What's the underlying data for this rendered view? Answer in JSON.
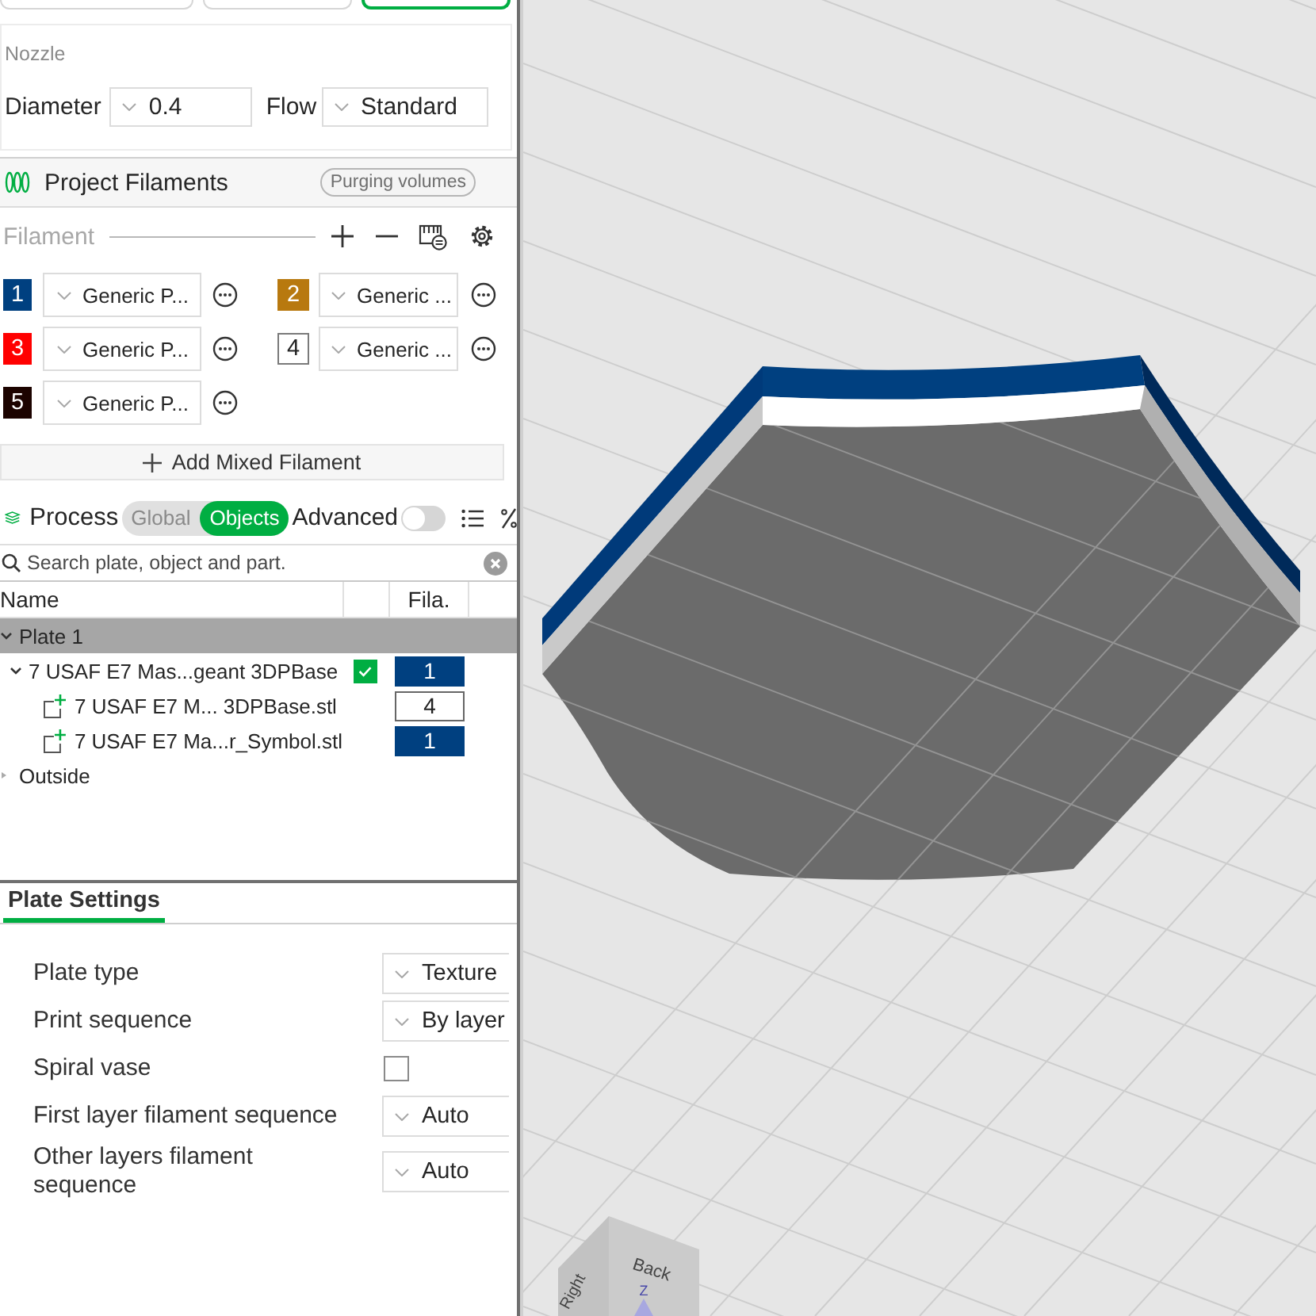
{
  "top_tabs": [
    {
      "selected": false
    },
    {
      "selected": false
    },
    {
      "selected": true
    }
  ],
  "nozzle": {
    "title": "Nozzle",
    "diameter_label": "Diameter",
    "diameter": "0.4",
    "flow_label": "Flow",
    "flow": "Standard"
  },
  "project_filaments": {
    "title": "Project Filaments",
    "purging_button": "Purging volumes",
    "filament_label": "Filament",
    "filaments": [
      {
        "number": "1",
        "color": "#004080",
        "name": "Generic P..."
      },
      {
        "number": "2",
        "color": "#b8790f",
        "name": "Generic ..."
      },
      {
        "number": "3",
        "color": "#ff0000",
        "name": "Generic P..."
      },
      {
        "number": "4",
        "color": "#ffffff",
        "name": "Generic ..."
      },
      {
        "number": "5",
        "color": "#1c0300",
        "name": "Generic P..."
      }
    ],
    "add_mixed_button": "Add Mixed Filament"
  },
  "process": {
    "title": "Process",
    "modes": [
      {
        "label": "Global",
        "selected": false
      },
      {
        "label": "Objects",
        "selected": true
      }
    ],
    "advanced_label": "Advanced",
    "advanced_on": false
  },
  "search": {
    "placeholder": "Search plate, object and part."
  },
  "object_table": {
    "columns": [
      "Name",
      "Fila."
    ],
    "rows": [
      {
        "kind": "plate",
        "name": "Plate 1",
        "selected": true,
        "expanded": true,
        "children": [
          {
            "kind": "object",
            "name": "7 USAF E7 Mas...geant 3DPBase",
            "selected": false,
            "expanded": true,
            "checked": true,
            "filament": {
              "label": "1",
              "color": "#004080"
            },
            "children": [
              {
                "kind": "part",
                "name": "7 USAF E7 M... 3DPBase.stl",
                "selected": false,
                "filament": {
                  "label": "4",
                  "color": "#ffffff"
                }
              },
              {
                "kind": "part",
                "name": "7 USAF E7 Ma...r_Symbol.stl",
                "selected": false,
                "filament": {
                  "label": "1",
                  "color": "#004080"
                }
              }
            ]
          }
        ]
      },
      {
        "kind": "plate",
        "name": "Outside",
        "selected": false,
        "expanded": false
      }
    ]
  },
  "plate_settings": {
    "tabs": [
      {
        "label": "Plate Settings",
        "selected": true
      }
    ],
    "settings": [
      {
        "kind": "dropdown",
        "label": "Plate type",
        "value": "Texture"
      },
      {
        "kind": "dropdown",
        "label": "Print sequence",
        "value": "By layer"
      },
      {
        "kind": "checkbox",
        "label": "Spiral vase",
        "checked": false
      },
      {
        "kind": "dropdown",
        "label": "First layer filament sequence",
        "value": "Auto"
      },
      {
        "kind": "dropdown",
        "label": "Other layers filament sequence",
        "value": "Auto"
      }
    ]
  },
  "viewport": {
    "view_cube": {
      "faces": [
        "Right",
        "Back"
      ],
      "axis": "Z"
    }
  }
}
